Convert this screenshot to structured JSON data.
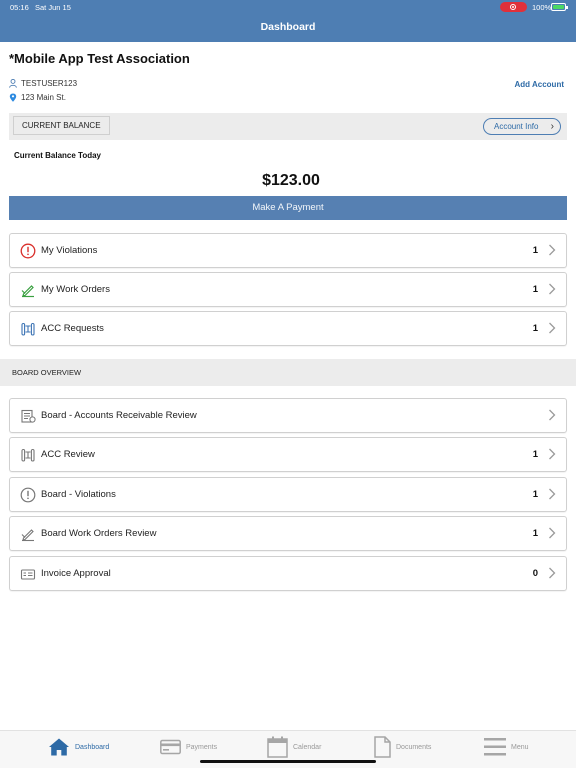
{
  "status_bar": {
    "time": "05:16",
    "date": "Sat Jun 15",
    "battery": "100%"
  },
  "header": {
    "title": "Dashboard"
  },
  "association": {
    "name": "*Mobile App Test Association",
    "user": "TESTUSER123",
    "address": "123 Main St.",
    "add_account": "Add Account"
  },
  "balance": {
    "tab_label": "CURRENT BALANCE",
    "account_info": "Account Info",
    "label": "Current Balance Today",
    "amount": "$123.00",
    "pay_button": "Make A Payment"
  },
  "items": [
    {
      "label": "My Violations",
      "count": "1",
      "icon": "violation-icon"
    },
    {
      "label": "My Work Orders",
      "count": "1",
      "icon": "work-order-icon"
    },
    {
      "label": "ACC Requests",
      "count": "1",
      "icon": "acc-icon"
    }
  ],
  "board": {
    "title": "BOARD OVERVIEW",
    "items": [
      {
        "label": "Board - Accounts Receivable Review",
        "count": "",
        "icon": "ledger-icon"
      },
      {
        "label": "ACC Review",
        "count": "1",
        "icon": "acc-icon"
      },
      {
        "label": "Board - Violations",
        "count": "1",
        "icon": "violation-icon"
      },
      {
        "label": "Board Work Orders Review",
        "count": "1",
        "icon": "work-order-icon"
      },
      {
        "label": "Invoice Approval",
        "count": "0",
        "icon": "invoice-icon"
      }
    ]
  },
  "tabbar": [
    {
      "label": "Dashboard",
      "icon": "home-icon",
      "active": true
    },
    {
      "label": "Payments",
      "icon": "card-icon",
      "active": false
    },
    {
      "label": "Calendar",
      "icon": "calendar-icon",
      "active": false
    },
    {
      "label": "Documents",
      "icon": "document-icon",
      "active": false
    },
    {
      "label": "Menu",
      "icon": "menu-icon",
      "active": false
    }
  ],
  "colors": {
    "brand": "#4e7eb3",
    "link": "#2d6aa6",
    "violation": "#d9302c",
    "work_order": "#3aa040",
    "acc": "#3c74b4"
  }
}
